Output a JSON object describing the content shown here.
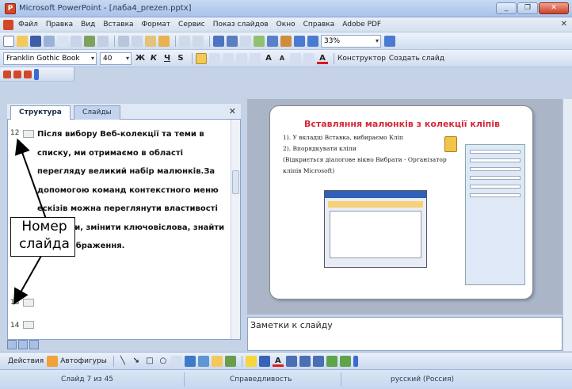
{
  "window": {
    "title": "Microsoft PowerPoint - [лаба4_prezen.pptx]"
  },
  "menu": {
    "items": [
      "Файл",
      "Правка",
      "Вид",
      "Вставка",
      "Формат",
      "Сервис",
      "Показ слайдов",
      "Окно",
      "Справка",
      "Adobe PDF"
    ]
  },
  "toolbar": {
    "zoom": "33%",
    "font_name": "Franklin Gothic Book",
    "font_size": "40",
    "designer_label": "Конструктор",
    "new_slide_label": "Создать слайд"
  },
  "outline": {
    "tabs": [
      "Структура",
      "Слайды"
    ],
    "paragraph": "Після вибору Веб-колекції та теми в списку, ми отримаємо в області перегляду великий набір малюнків.За допомогою команд контекстного меню ескізів можна переглянути властивості картинки, змінити ключовіслова, знайти схожі зображення.",
    "slide_numbers": [
      "12",
      "13",
      "14"
    ]
  },
  "callout": {
    "text": "Номер слайда"
  },
  "slide": {
    "title": "Вставляння малюнків з колекції кліпів",
    "body": [
      "1). У вкладці Вставка, вибираємо Кліп",
      "2). Впорядкувати кліпи",
      "(Відкриється діалогове вікно Вибрати - Організатор кліпів Microsoft)"
    ]
  },
  "notes": {
    "placeholder": "Заметки к слайду"
  },
  "drawing": {
    "actions_label": "Действия",
    "autoshapes_label": "Автофигуры"
  },
  "status": {
    "slide": "Слайд 7 из 45",
    "design": "Справедливость",
    "language": "русский (Россия)"
  },
  "colors": {
    "slide_title": "#d5283a",
    "office_blue": "#c6d3e6"
  }
}
